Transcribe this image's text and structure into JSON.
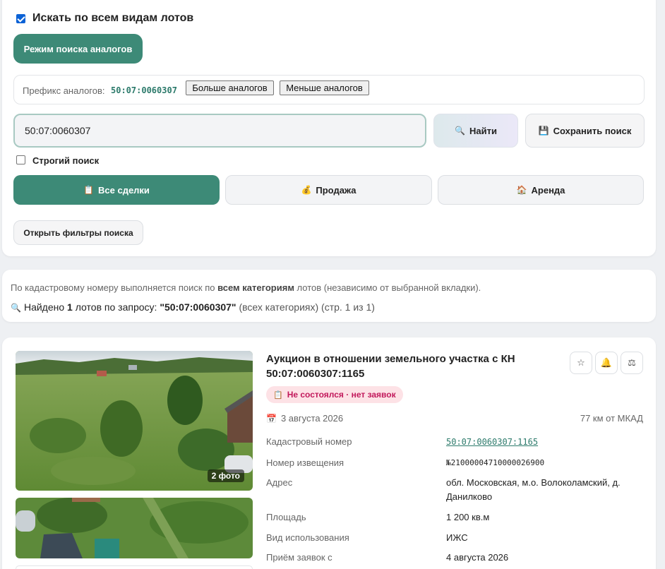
{
  "search": {
    "search_all_types_label": "Искать по всем видам лотов",
    "analog_mode_button": "Режим поиска аналогов",
    "prefix_label": "Префикс аналогов:",
    "prefix_value": "50:07:0060307",
    "more_analogs_button": "Больше аналогов",
    "fewer_analogs_button": "Меньше аналогов",
    "query_value": "50:07:0060307",
    "find_button": "Найти",
    "save_search_button": "Сохранить поиск",
    "strict_search_label": "Строгий поиск",
    "tabs": [
      {
        "icon": "📋",
        "label": "Все сделки",
        "active": true
      },
      {
        "icon": "💰",
        "label": "Продажа",
        "active": false
      },
      {
        "icon": "🏠",
        "label": "Аренда",
        "active": false
      }
    ],
    "open_filters_button": "Открыть фильтры поиска"
  },
  "info": {
    "line1_pre": "По кадастровому номеру выполняется поиск по ",
    "line1_bold": "всем категориям",
    "line1_post": " лотов (независимо от выбранной вкладки).",
    "found_pre": "Найдено ",
    "found_count": "1",
    "found_mid": " лотов по запросу: ",
    "found_query": "\"50:07:0060307\"",
    "found_post": " (всех категориях) (стр. 1 из 1)"
  },
  "lot": {
    "title": "Аукцион в отношении земельного участка с КН 50:07:0060307:1165",
    "status_icon": "📋",
    "status": "Не состоялся · нет заявок",
    "date": "3 августа 2026",
    "distance": "77 км от МКАД",
    "photo_count": "2 фото",
    "rows": [
      {
        "label": "Кадастровый номер",
        "value": "50:07:0060307:1165"
      },
      {
        "label": "Номер извещения",
        "value": "№21000004710000026900"
      },
      {
        "label": "Адрес",
        "value": "обл. Московская, м.о. Волоколамский, д. Данилково"
      },
      {
        "label": "Площадь",
        "value": "1 200 кв.м"
      },
      {
        "label": "Вид использования",
        "value": "ИЖС"
      },
      {
        "label": "Приём заявок с",
        "value": "4 августа 2026"
      }
    ],
    "actions": {
      "star": "☆",
      "bell": "🔔",
      "compare": "⚖"
    }
  },
  "colors": {
    "accent": "#3d8a77",
    "status_bg": "#fde2e6",
    "status_text": "#c2185b",
    "link": "#2c7a6b"
  }
}
